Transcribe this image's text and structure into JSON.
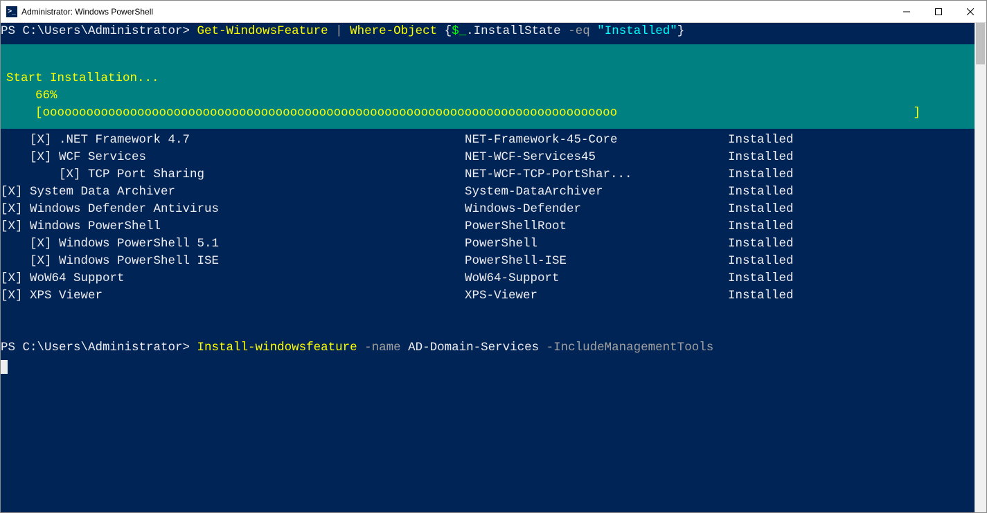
{
  "window": {
    "title": "Administrator: Windows PowerShell",
    "icon_label": ">_"
  },
  "cmd1": {
    "prompt": "PS C:\\Users\\Administrator> ",
    "cmdlet1": "Get-WindowsFeature",
    "pipe": " | ",
    "cmdlet2": "Where-Object ",
    "lbrace": "{",
    "var": "$_",
    "rest": ".InstallState ",
    "op": "-eq ",
    "str": "\"Installed\"",
    "rbrace": "}"
  },
  "progress": {
    "title": "Start Installation...",
    "percent_label": "    66%",
    "bar_left": "    [",
    "bar_fill": "ooooooooooooooooooooooooooooooooooooooooooooooooooooooooooooooooooooooooooooooo",
    "bar_right": "]"
  },
  "features": [
    {
      "indent": 1,
      "display": "[X] .NET Framework 4.7",
      "name": "NET-Framework-45-Core",
      "state": "Installed"
    },
    {
      "indent": 1,
      "display": "[X] WCF Services",
      "name": "NET-WCF-Services45",
      "state": "Installed"
    },
    {
      "indent": 2,
      "display": "[X] TCP Port Sharing",
      "name": "NET-WCF-TCP-PortShar...",
      "state": "Installed"
    },
    {
      "indent": 0,
      "display": "[X] System Data Archiver",
      "name": "System-DataArchiver",
      "state": "Installed"
    },
    {
      "indent": 0,
      "display": "[X] Windows Defender Antivirus",
      "name": "Windows-Defender",
      "state": "Installed"
    },
    {
      "indent": 0,
      "display": "[X] Windows PowerShell",
      "name": "PowerShellRoot",
      "state": "Installed"
    },
    {
      "indent": 1,
      "display": "[X] Windows PowerShell 5.1",
      "name": "PowerShell",
      "state": "Installed"
    },
    {
      "indent": 1,
      "display": "[X] Windows PowerShell ISE",
      "name": "PowerShell-ISE",
      "state": "Installed"
    },
    {
      "indent": 0,
      "display": "[X] WoW64 Support",
      "name": "WoW64-Support",
      "state": "Installed"
    },
    {
      "indent": 0,
      "display": "[X] XPS Viewer",
      "name": "XPS-Viewer",
      "state": "Installed"
    }
  ],
  "cmd2": {
    "prompt": "PS C:\\Users\\Administrator> ",
    "cmdlet": "Install-windowsfeature ",
    "param1": "-name ",
    "arg1": "AD-Domain-Services ",
    "param2": "-IncludeManagementTools"
  }
}
